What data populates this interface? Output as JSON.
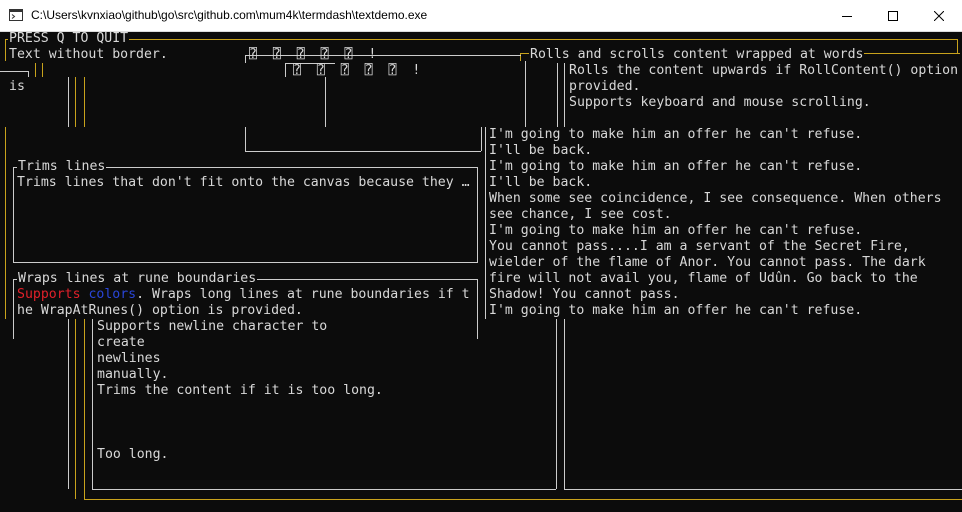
{
  "window": {
    "title": "C:\\Users\\kvnxiao\\github\\go\\src\\github.com\\mum4k\\termdash\\textdemo.exe",
    "icon": "console-app-icon",
    "controls": [
      "minimize-icon",
      "maximize-icon",
      "close-icon"
    ]
  },
  "colors": {
    "border_outer": "#c8a21c",
    "border_inner": "#cccccc",
    "red_text": "#e0202a",
    "blue_text": "#2945d8"
  },
  "console": {
    "quit_title": "PRESS Q TO QUIT",
    "no_border_text": "Text without border.",
    "unicode_row1": "⍰ ⍰ ⍰ ⍰ ⍰ !",
    "unicode_row2": "⍰ ⍰ ⍰ ⍰ ⍰ !",
    "left_fragment": "is",
    "rolls": {
      "title": "Rolls and scrolls content wrapped at words",
      "lines": [
        "Rolls the content upwards if RollContent() option",
        "provided.",
        "Supports keyboard and mouse scrolling."
      ]
    },
    "quotes": [
      "I'm going to make him an offer he can't refuse.",
      "I'll be back.",
      "I'm going to make him an offer he can't refuse.",
      "I'll be back.",
      "When some see coincidence, I see consequence. When others",
      "see chance, I see cost.",
      "I'm going to make him an offer he can't refuse.",
      "You cannot pass....I am a servant of the Secret Fire,",
      "wielder of the flame of Anor. You cannot pass. The dark",
      "fire will not avail you, flame of Udûn. Go back to the",
      "Shadow! You cannot pass.",
      "I'm going to make him an offer he can't refuse."
    ],
    "trims": {
      "title": "Trims lines",
      "text": "Trims lines that don't fit onto the canvas because they …"
    },
    "wraps": {
      "title": "Wraps lines at rune boundaries",
      "red_text": "Supports",
      "blue_text": "colors",
      "rest_text": ". Wraps long lines at rune boundaries if t",
      "line2": "he WrapAtRunes() option is provided."
    },
    "newline_lines": [
      "Supports newline character to",
      "create",
      "newlines",
      "manually.",
      "Trims the content if it is too long."
    ],
    "too_long": "Too long."
  }
}
